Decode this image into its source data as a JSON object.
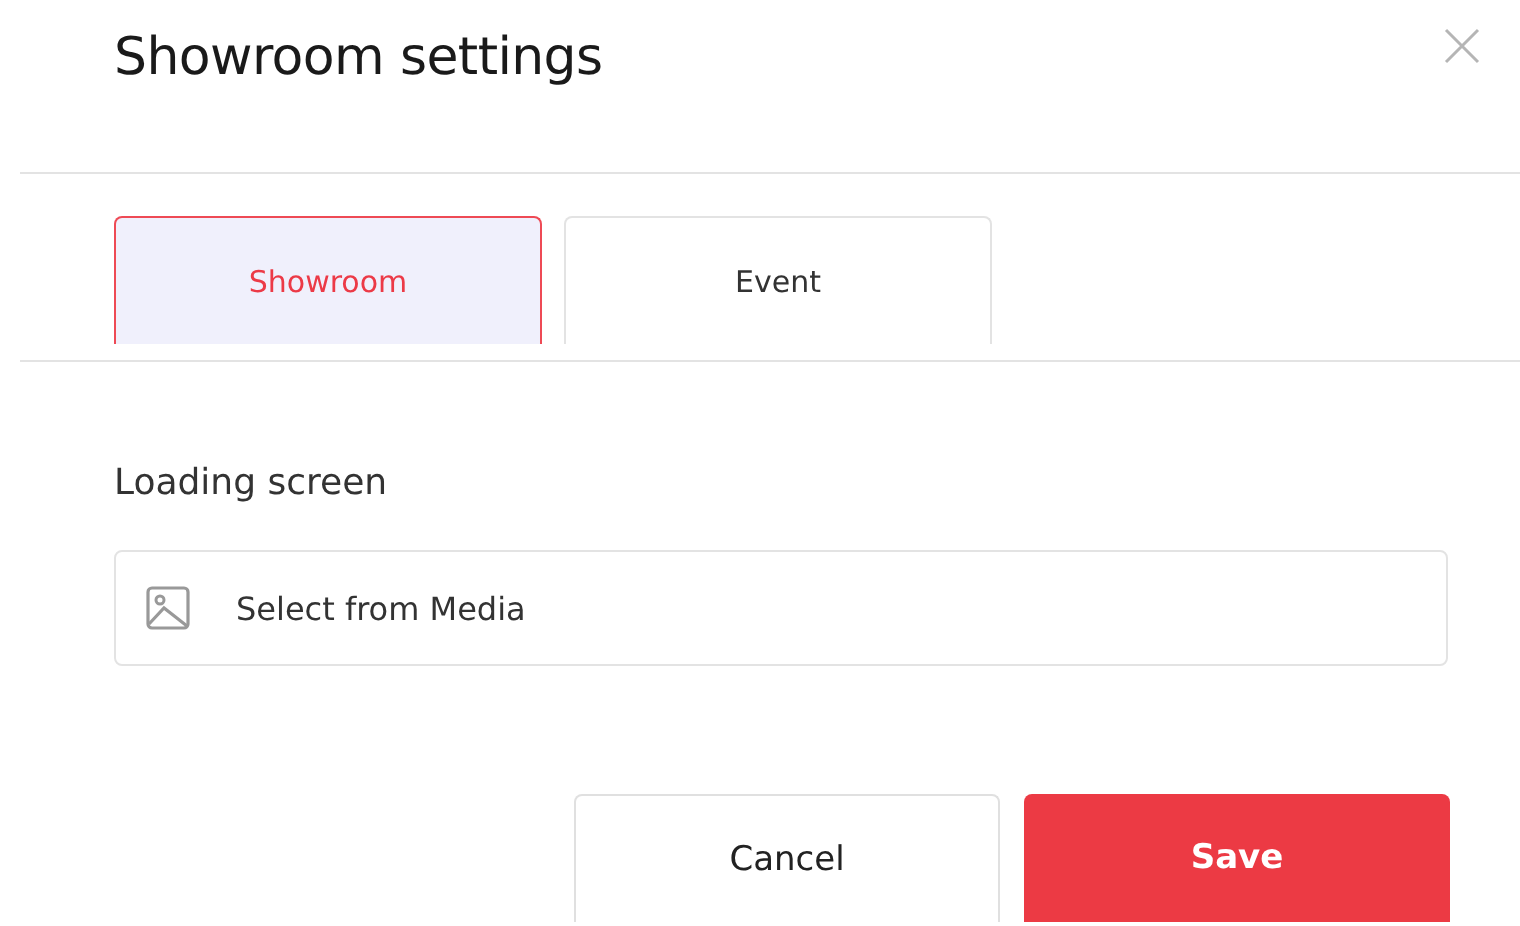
{
  "dialog": {
    "title": "Showroom settings"
  },
  "tabs": [
    {
      "label": "Showroom",
      "selected": true
    },
    {
      "label": "Event",
      "selected": false
    }
  ],
  "loading_screen": {
    "label": "Loading screen",
    "placeholder": "Select from Media"
  },
  "buttons": [
    {
      "label": "Cancel",
      "kind": "secondary"
    },
    {
      "label": "Save",
      "kind": "primary"
    }
  ]
}
